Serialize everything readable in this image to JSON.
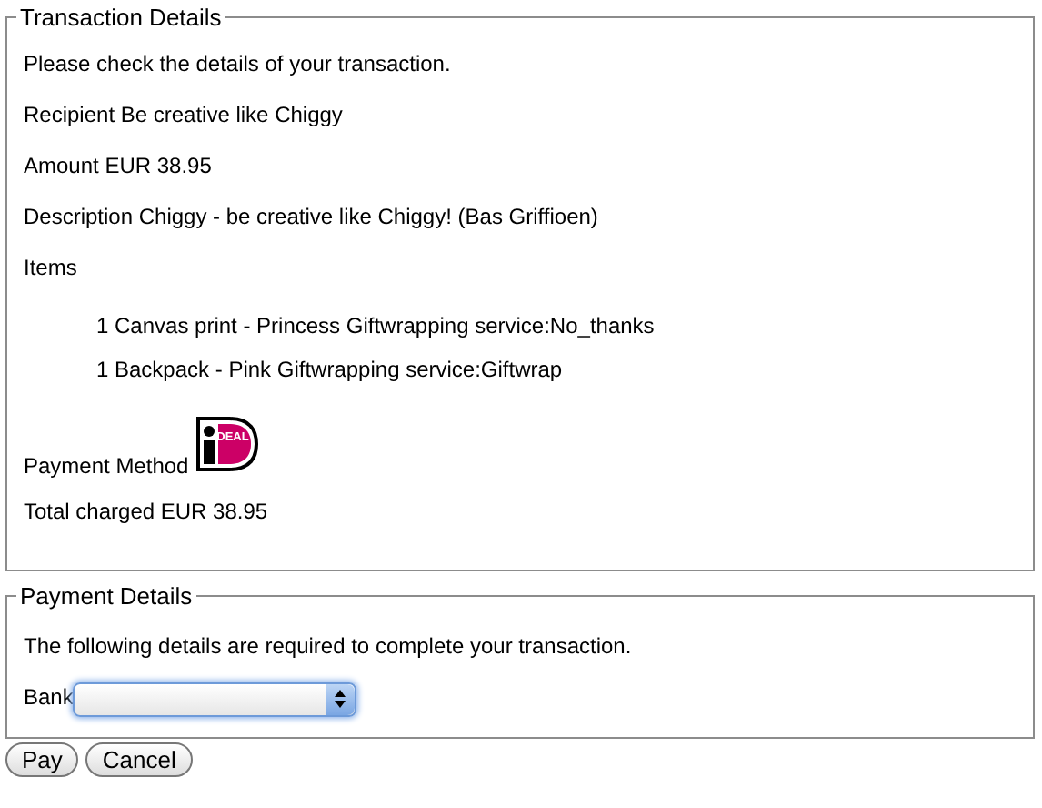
{
  "transaction": {
    "legend": "Transaction Details",
    "intro": "Please check the details of your transaction.",
    "recipient": "Recipient Be creative like Chiggy",
    "amount": "Amount EUR 38.95",
    "description": "Description Chiggy - be creative like Chiggy! (Bas Griffioen)",
    "items_label": "Items",
    "items": [
      "1 Canvas print - Princess Giftwrapping service:No_thanks",
      "1 Backpack - Pink Giftwrapping service:Giftwrap"
    ],
    "payment_method": {
      "label": "Payment Method",
      "logo_text": "DEAL"
    },
    "total": "Total charged EUR 38.95"
  },
  "payment": {
    "legend": "Payment Details",
    "intro": "The following details are required to complete your transaction.",
    "bank_label": "Bank"
  },
  "buttons": [
    "Pay",
    "Cancel"
  ]
}
